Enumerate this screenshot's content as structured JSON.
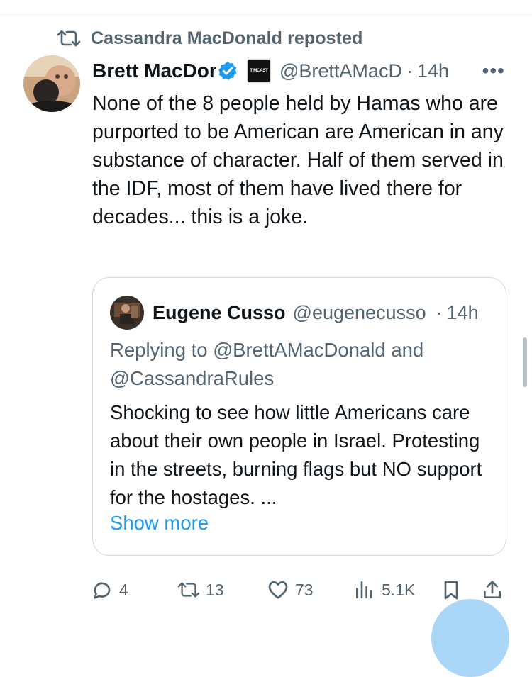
{
  "repost": {
    "label": "Cassandra MacDonald reposted"
  },
  "tweet": {
    "author_name": "Brett MacDonald",
    "handle": "@BrettAMacD",
    "separator": "·",
    "time": "14h",
    "more_label": "•••",
    "affiliation_badge": "TIMCAST",
    "text": "None of the 8 people held by Hamas who are purported to be American are American in any substance of character. Half of them served in the IDF, most of them have lived there for decades... this is a joke."
  },
  "quote": {
    "author_name": "Eugene Cusso",
    "handle": "@eugenecusso",
    "separator": "·",
    "time": "14h",
    "reply_prefix": "Replying to",
    "reply_mention_1": "@BrettAMacDonald",
    "reply_and": "and",
    "reply_mention_2": "@CassandraRules",
    "text": "Shocking to see how little Americans care about their own people in Israel. Protesting in the streets, burning flags but NO support for the hostages. ...",
    "show_more": "Show more"
  },
  "actions": {
    "replies": "4",
    "reposts": "13",
    "likes": "73",
    "views": "5.1K"
  },
  "colors": {
    "text": "#0f1419",
    "secondary": "#536471",
    "accent": "#1d9bf0",
    "border": "#cfd9de"
  },
  "icons": [
    "repost-icon",
    "verified-badge-icon",
    "reply-icon",
    "like-icon",
    "views-icon",
    "bookmark-icon",
    "share-icon"
  ]
}
